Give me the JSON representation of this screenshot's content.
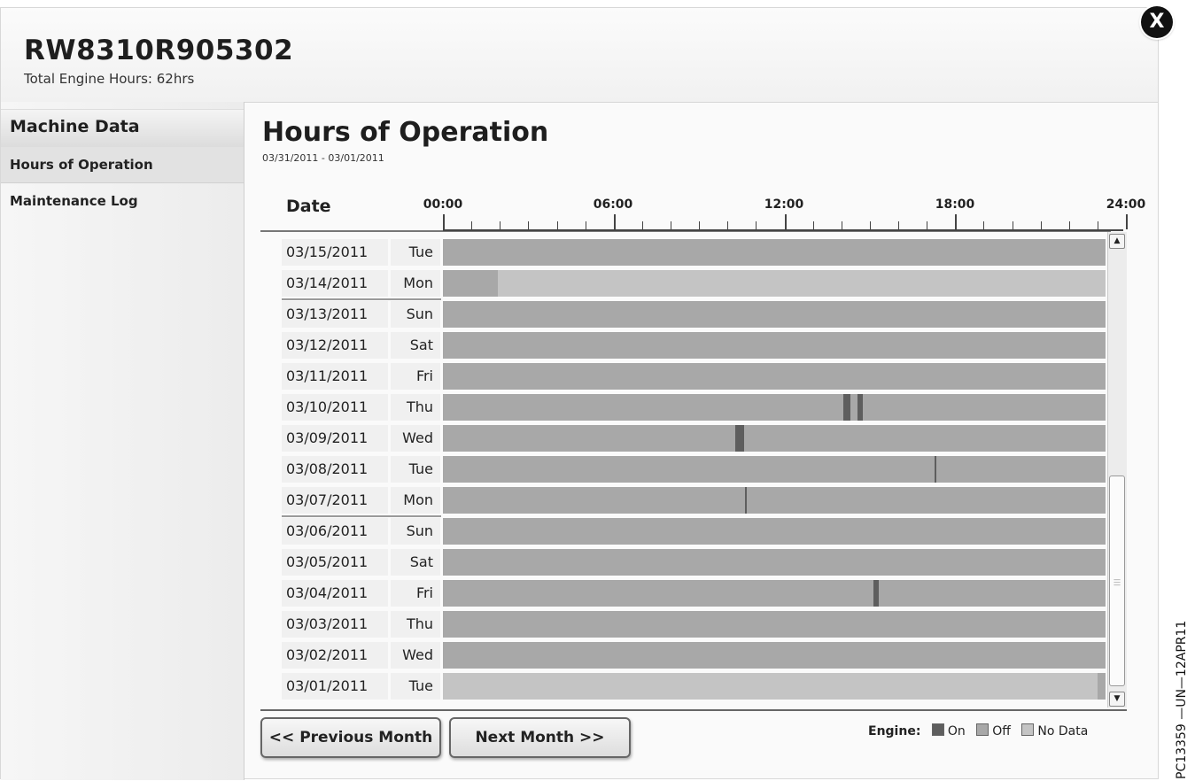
{
  "header": {
    "machine_id": "RW8310R905302",
    "engine_hours": "Total Engine Hours: 62hrs",
    "close_label": "X"
  },
  "sidebar": {
    "title": "Machine Data",
    "items": [
      {
        "label": "Hours of Operation",
        "active": true
      },
      {
        "label": "Maintenance Log",
        "active": false
      }
    ]
  },
  "main": {
    "title": "Hours of Operation",
    "date_range": "03/31/2011 - 03/01/2011",
    "date_column_header": "Date",
    "hour_labels": [
      "00:00",
      "06:00",
      "12:00",
      "18:00",
      "24:00"
    ]
  },
  "colors": {
    "on": "#5e5e5e",
    "off": "#a8a8a8",
    "no_data": "#c4c4c4"
  },
  "rows": [
    {
      "date": "03/15/2011",
      "day": "Tue",
      "segments": []
    },
    {
      "date": "03/14/2011",
      "day": "Mon",
      "segments": [
        {
          "start": 2.0,
          "end": 24.0,
          "state": "no_data"
        }
      ]
    },
    {
      "date": "03/13/2011",
      "day": "Sun",
      "segments": []
    },
    {
      "date": "03/12/2011",
      "day": "Sat",
      "segments": []
    },
    {
      "date": "03/11/2011",
      "day": "Fri",
      "segments": []
    },
    {
      "date": "03/10/2011",
      "day": "Thu",
      "segments": [
        {
          "start": 14.5,
          "end": 14.75,
          "state": "on"
        },
        {
          "start": 15.0,
          "end": 15.2,
          "state": "on"
        }
      ]
    },
    {
      "date": "03/09/2011",
      "day": "Wed",
      "segments": [
        {
          "start": 10.6,
          "end": 10.9,
          "state": "on"
        }
      ]
    },
    {
      "date": "03/08/2011",
      "day": "Tue",
      "segments": [
        {
          "start": 17.8,
          "end": 17.85,
          "state": "on"
        }
      ]
    },
    {
      "date": "03/07/2011",
      "day": "Mon",
      "segments": [
        {
          "start": 10.95,
          "end": 11.0,
          "state": "on"
        }
      ]
    },
    {
      "date": "03/06/2011",
      "day": "Sun",
      "segments": []
    },
    {
      "date": "03/05/2011",
      "day": "Sat",
      "segments": []
    },
    {
      "date": "03/04/2011",
      "day": "Fri",
      "segments": [
        {
          "start": 15.6,
          "end": 15.8,
          "state": "on"
        }
      ]
    },
    {
      "date": "03/03/2011",
      "day": "Thu",
      "segments": []
    },
    {
      "date": "03/02/2011",
      "day": "Wed",
      "segments": []
    },
    {
      "date": "03/01/2011",
      "day": "Tue",
      "segments": [
        {
          "start": 0.0,
          "end": 23.7,
          "state": "no_data"
        }
      ]
    }
  ],
  "buttons": {
    "prev": "<< Previous Month",
    "next": "Next Month >>"
  },
  "legend": {
    "label": "Engine:",
    "on": "On",
    "off": "Off",
    "no_data": "No Data"
  },
  "watermark": "PC13359 —UN—12APR11"
}
